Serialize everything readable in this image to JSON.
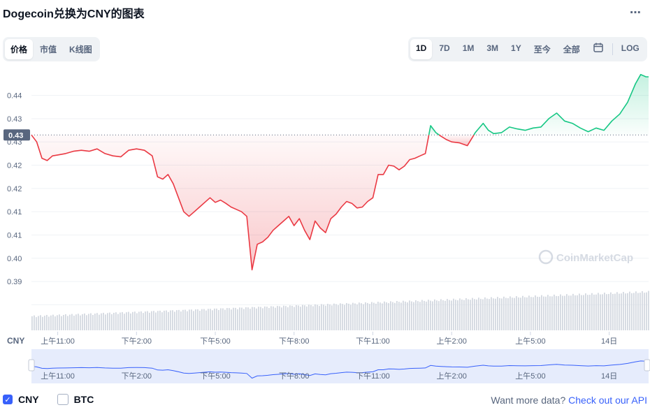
{
  "title": "Dogecoin兑换为CNY的图表",
  "more_icon": "⋯",
  "view_tabs": [
    {
      "label": "价格",
      "active": true
    },
    {
      "label": "市值",
      "active": false
    },
    {
      "label": "K线图",
      "active": false
    }
  ],
  "range_tabs": [
    {
      "label": "1D",
      "active": true
    },
    {
      "label": "7D",
      "active": false
    },
    {
      "label": "1M",
      "active": false
    },
    {
      "label": "3M",
      "active": false
    },
    {
      "label": "1Y",
      "active": false
    },
    {
      "label": "至今",
      "active": false
    },
    {
      "label": "全部",
      "active": false
    }
  ],
  "log_label": "LOG",
  "watermark": "CoinMarketCap",
  "options": [
    {
      "label": "CNY",
      "checked": true
    },
    {
      "label": "BTC",
      "checked": false
    }
  ],
  "footer": {
    "text": "Want more data?",
    "link": "Check out our API"
  },
  "colors": {
    "up": "#16c784",
    "down": "#ea3943",
    "accent": "#3861fb",
    "nav_line": "#3861fb"
  },
  "chart_data": {
    "type": "line",
    "currency_label": "CNY",
    "open_price": 0.4315,
    "current_label": "0.43",
    "ylim": [
      0.3895,
      0.4455
    ],
    "y_ticks": [
      0.44,
      0.435,
      0.43,
      0.425,
      0.42,
      0.415,
      0.41,
      0.405,
      0.4,
      0.395
    ],
    "y_tick_labels": [
      "0.44",
      "0.43",
      "0.43",
      "0.42",
      "0.42",
      "0.41",
      "0.41",
      "0.40",
      "0.39"
    ],
    "x_ticks": [
      {
        "t": 11.0,
        "label": "上午11:00"
      },
      {
        "t": 14.0,
        "label": "下午2:00"
      },
      {
        "t": 17.0,
        "label": "下午5:00"
      },
      {
        "t": 20.0,
        "label": "下午8:00"
      },
      {
        "t": 23.0,
        "label": "下午11:00"
      },
      {
        "t": 26.0,
        "label": "上午2:00"
      },
      {
        "t": 29.0,
        "label": "上午5:00"
      },
      {
        "t": 32.0,
        "label": "14日"
      }
    ],
    "xlim": [
      10.0,
      33.5
    ],
    "x": [
      10.0,
      10.2,
      10.4,
      10.6,
      10.8,
      11.0,
      11.3,
      11.6,
      11.9,
      12.2,
      12.5,
      12.8,
      13.1,
      13.4,
      13.7,
      14.0,
      14.3,
      14.6,
      14.8,
      15.0,
      15.2,
      15.4,
      15.6,
      15.8,
      16.0,
      16.2,
      16.4,
      16.6,
      16.8,
      17.0,
      17.2,
      17.4,
      17.6,
      17.8,
      18.0,
      18.2,
      18.4,
      18.6,
      18.8,
      19.0,
      19.2,
      19.4,
      19.6,
      19.8,
      20.0,
      20.2,
      20.4,
      20.6,
      20.8,
      21.0,
      21.2,
      21.4,
      21.6,
      21.8,
      22.0,
      22.2,
      22.4,
      22.6,
      22.8,
      23.0,
      23.2,
      23.4,
      23.6,
      23.8,
      24.0,
      24.2,
      24.4,
      24.6,
      24.8,
      25.0,
      25.2,
      25.4,
      25.6,
      25.8,
      26.0,
      26.3,
      26.6,
      26.9,
      27.2,
      27.4,
      27.6,
      27.9,
      28.2,
      28.5,
      28.8,
      29.1,
      29.4,
      29.7,
      30.0,
      30.3,
      30.6,
      30.9,
      31.2,
      31.5,
      31.8,
      32.1,
      32.4,
      32.7,
      33.0,
      33.2,
      33.4,
      33.5
    ],
    "values": [
      0.4315,
      0.43,
      0.4265,
      0.426,
      0.427,
      0.4272,
      0.4275,
      0.428,
      0.4282,
      0.428,
      0.4285,
      0.4275,
      0.427,
      0.4268,
      0.4282,
      0.4285,
      0.4282,
      0.427,
      0.4225,
      0.422,
      0.423,
      0.421,
      0.418,
      0.415,
      0.414,
      0.415,
      0.416,
      0.417,
      0.418,
      0.417,
      0.4175,
      0.4168,
      0.416,
      0.4155,
      0.415,
      0.414,
      0.4025,
      0.408,
      0.4085,
      0.4095,
      0.411,
      0.412,
      0.413,
      0.414,
      0.412,
      0.4135,
      0.411,
      0.409,
      0.413,
      0.4115,
      0.4105,
      0.4135,
      0.4145,
      0.416,
      0.4172,
      0.4168,
      0.4158,
      0.416,
      0.4172,
      0.418,
      0.423,
      0.423,
      0.425,
      0.4248,
      0.424,
      0.4248,
      0.4262,
      0.4265,
      0.427,
      0.4275,
      0.4335,
      0.432,
      0.4312,
      0.4305,
      0.43,
      0.4298,
      0.4292,
      0.432,
      0.434,
      0.4325,
      0.4318,
      0.432,
      0.4332,
      0.4328,
      0.4325,
      0.433,
      0.4332,
      0.435,
      0.4362,
      0.4345,
      0.434,
      0.433,
      0.4322,
      0.433,
      0.4325,
      0.4345,
      0.436,
      0.4385,
      0.4425,
      0.4445,
      0.444,
      0.444
    ],
    "volume_hint": "rising"
  }
}
